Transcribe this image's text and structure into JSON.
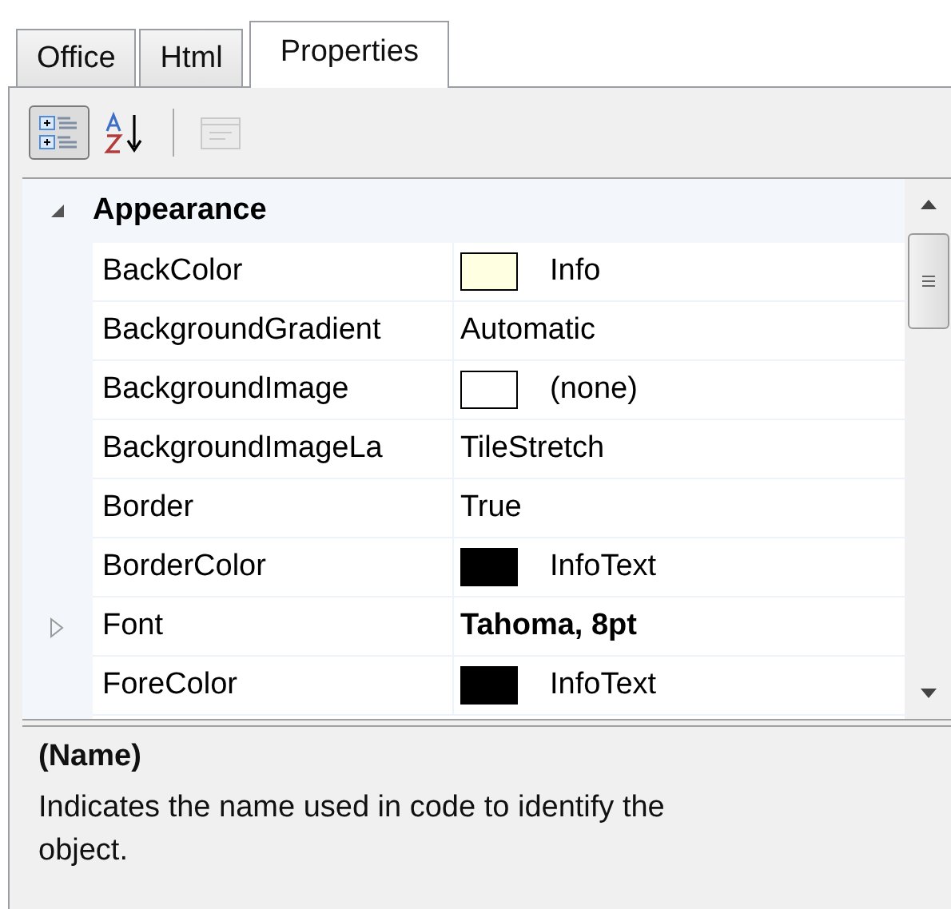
{
  "tabs": [
    {
      "label": "Office",
      "selected": false
    },
    {
      "label": "Html",
      "selected": false
    },
    {
      "label": "Properties",
      "selected": true
    }
  ],
  "toolbar": [
    {
      "kind": "categorized",
      "selected": true,
      "disabled": false
    },
    {
      "kind": "alphabetical",
      "selected": false,
      "disabled": false
    },
    {
      "kind": "property-pages",
      "selected": false,
      "disabled": true
    }
  ],
  "category": {
    "name": "Appearance",
    "expanded": true
  },
  "rows": [
    {
      "name": "BackColor",
      "value": "Info",
      "kind": "color",
      "color": "#ffffe1",
      "modified": false
    },
    {
      "name": "BackgroundGradient",
      "value": "Automatic",
      "kind": "text",
      "modified": false
    },
    {
      "name": "BackgroundImage",
      "value": "(none)",
      "kind": "color",
      "color": "#ffffff",
      "modified": false
    },
    {
      "name": "BackgroundImageLa",
      "value": "TileStretch",
      "kind": "text",
      "modified": false
    },
    {
      "name": "Border",
      "value": "True",
      "kind": "text",
      "modified": false
    },
    {
      "name": "BorderColor",
      "value": "InfoText",
      "kind": "color",
      "color": "#000000",
      "modified": false
    },
    {
      "name": "Font",
      "value": "Tahoma, 8pt",
      "kind": "group",
      "expanded": false,
      "modified": true
    },
    {
      "name": "ForeColor",
      "value": "InfoText",
      "kind": "color",
      "color": "#000000",
      "modified": false
    }
  ],
  "description": {
    "title": "(Name)",
    "text": "Indicates the name used in code to identify the object."
  }
}
